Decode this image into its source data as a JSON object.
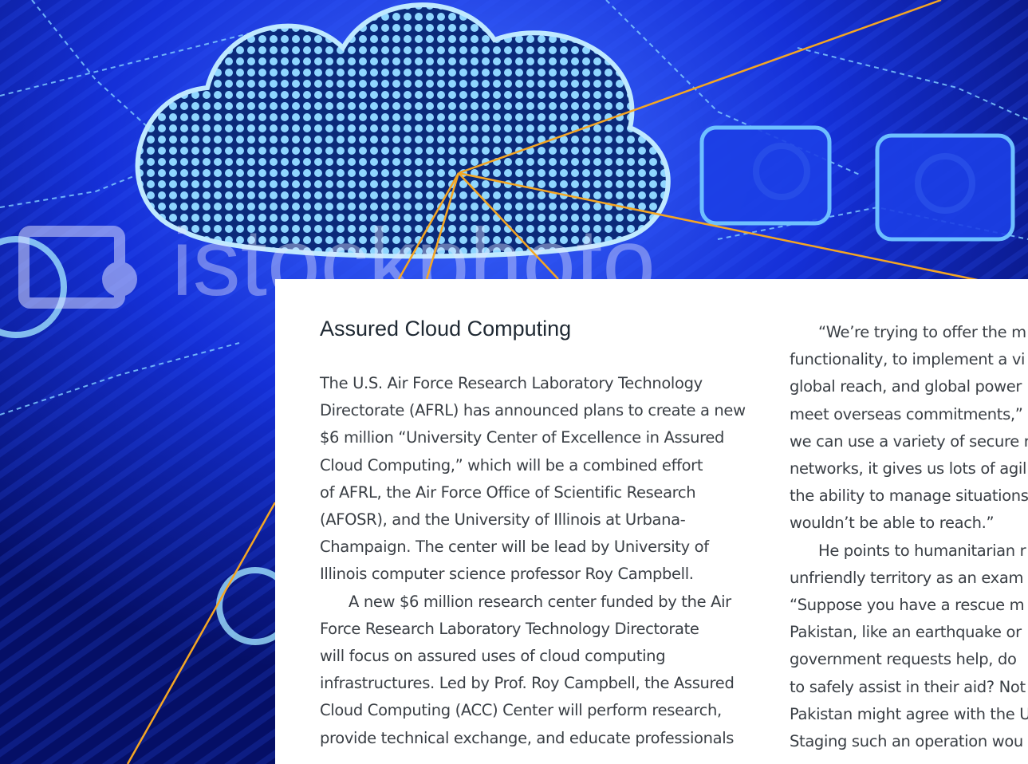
{
  "article": {
    "title": "Assured Cloud Computing",
    "left_lines": [
      "The U.S. Air Force Research Laboratory Technology",
      "Directorate (AFRL) has announced plans to create a new",
      "$6 million “University Center of Excellence in Assured",
      "Cloud Computing,” which will be a combined effort",
      "of AFRL, the Air Force Office of Scientific Research",
      "(AFOSR), and the University of Illinois at Urbana-",
      "Champaign. The center will be lead by University of",
      "Illinois computer science professor Roy Campbell.",
      "A new $6 million research center funded by the Air",
      "Force Research Laboratory Technology Directorate",
      "will focus on assured uses of cloud computing",
      "infrastructures. Led by Prof. Roy Campbell, the Assured",
      "Cloud Computing (ACC) Center will perform research,",
      "provide technical exchange, and educate professionals"
    ],
    "right_lines": [
      "“We’re trying to offer the m",
      "functionality, to implement a vi",
      "global reach, and global power",
      "meet overseas commitments,”",
      "we can use a variety of secure r",
      "networks, it gives us lots of agil",
      "the ability to manage situations",
      "wouldn’t be able to reach.”",
      "He points to humanitarian r",
      "unfriendly territory as an exam",
      "“Suppose you have a rescue m",
      "Pakistan, like an earthquake or",
      "government requests help, do",
      "to safely assist in their aid? Not",
      "Pakistan might agree with the U",
      "Staging such an operation wou"
    ]
  },
  "background": {
    "watermark": "istockphoto",
    "accent_color": "#f5a623",
    "base_color": "#0a1a8c"
  }
}
